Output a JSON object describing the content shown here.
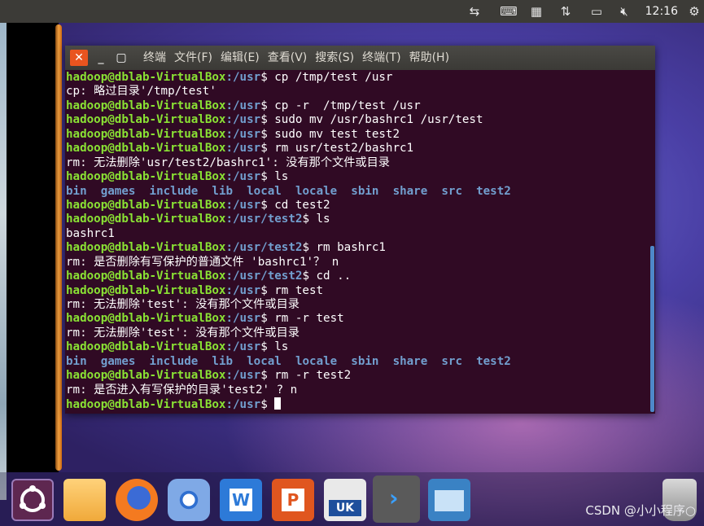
{
  "top_panel": {
    "clock": "12:16",
    "tray_icons": [
      "transfer-icon",
      "keyboard-icon",
      "calendar-icon",
      "network-icon",
      "battery-icon",
      "mute-icon",
      "gear-icon"
    ]
  },
  "terminal": {
    "close_label": "✕",
    "minimize_label": "_",
    "maximize_label": "▢",
    "menu": [
      "终端",
      "文件(F)",
      "编辑(E)",
      "查看(V)",
      "搜索(S)",
      "终端(T)",
      "帮助(H)"
    ],
    "prompt_user": "hadoop@dblab-VirtualBox",
    "lines": [
      {
        "type": "cmd",
        "path": ":/usr",
        "text": "$ cp /tmp/test /usr"
      },
      {
        "type": "out",
        "text": "cp: 略过目录'/tmp/test'"
      },
      {
        "type": "cmd",
        "path": ":/usr",
        "text": "$ cp -r  /tmp/test /usr"
      },
      {
        "type": "cmd",
        "path": ":/usr",
        "text": "$ sudo mv /usr/bashrc1 /usr/test"
      },
      {
        "type": "cmd",
        "path": ":/usr",
        "text": "$ sudo mv test test2"
      },
      {
        "type": "cmd",
        "path": ":/usr",
        "text": "$ rm usr/test2/bashrc1"
      },
      {
        "type": "out",
        "text": "rm: 无法删除'usr/test2/bashrc1': 没有那个文件或目录"
      },
      {
        "type": "cmd",
        "path": ":/usr",
        "text": "$ ls"
      },
      {
        "type": "ls",
        "items": [
          "bin",
          "games",
          "include",
          "lib",
          "local",
          "locale",
          "sbin",
          "share",
          "src",
          "test2"
        ]
      },
      {
        "type": "cmd",
        "path": ":/usr",
        "text": "$ cd test2"
      },
      {
        "type": "cmd",
        "path": ":/usr/test2",
        "text": "$ ls"
      },
      {
        "type": "out",
        "text": "bashrc1"
      },
      {
        "type": "cmd",
        "path": ":/usr/test2",
        "text": "$ rm bashrc1"
      },
      {
        "type": "out",
        "text": "rm: 是否删除有写保护的普通文件 'bashrc1'？ n"
      },
      {
        "type": "cmd",
        "path": ":/usr/test2",
        "text": "$ cd .."
      },
      {
        "type": "cmd",
        "path": ":/usr",
        "text": "$ rm test"
      },
      {
        "type": "out",
        "text": "rm: 无法删除'test': 没有那个文件或目录"
      },
      {
        "type": "cmd",
        "path": ":/usr",
        "text": "$ rm -r test"
      },
      {
        "type": "out",
        "text": "rm: 无法删除'test': 没有那个文件或目录"
      },
      {
        "type": "cmd",
        "path": ":/usr",
        "text": "$ ls"
      },
      {
        "type": "ls",
        "items": [
          "bin",
          "games",
          "include",
          "lib",
          "local",
          "locale",
          "sbin",
          "share",
          "src",
          "test2"
        ]
      },
      {
        "type": "cmd",
        "path": ":/usr",
        "text": "$ rm -r test2"
      },
      {
        "type": "out",
        "text": "rm: 是否进入有写保护的目录'test2' ? n"
      },
      {
        "type": "cmd",
        "path": ":/usr",
        "text": "$ ",
        "cursor": true
      }
    ]
  },
  "dock": {
    "items": [
      {
        "name": "ubuntu-logo-icon",
        "color": "#5e2750"
      },
      {
        "name": "files-icon",
        "color": "#f5b74a"
      },
      {
        "name": "firefox-icon",
        "color": "#e8611c"
      },
      {
        "name": "chromium-icon",
        "color": "#5b8ed6"
      },
      {
        "name": "writer-icon",
        "color": "#2d7ad8"
      },
      {
        "name": "impress-icon",
        "color": "#e0561f"
      },
      {
        "name": "software-center-icon",
        "color": "#e9e9e9"
      },
      {
        "name": "terminal-app-icon",
        "color": "#4a4a4a"
      },
      {
        "name": "workspace-icon",
        "color": "#3a82c4"
      }
    ],
    "uk_label": "UK",
    "trash_icon": "trash-icon"
  },
  "watermark": "CSDN @小小程序○"
}
